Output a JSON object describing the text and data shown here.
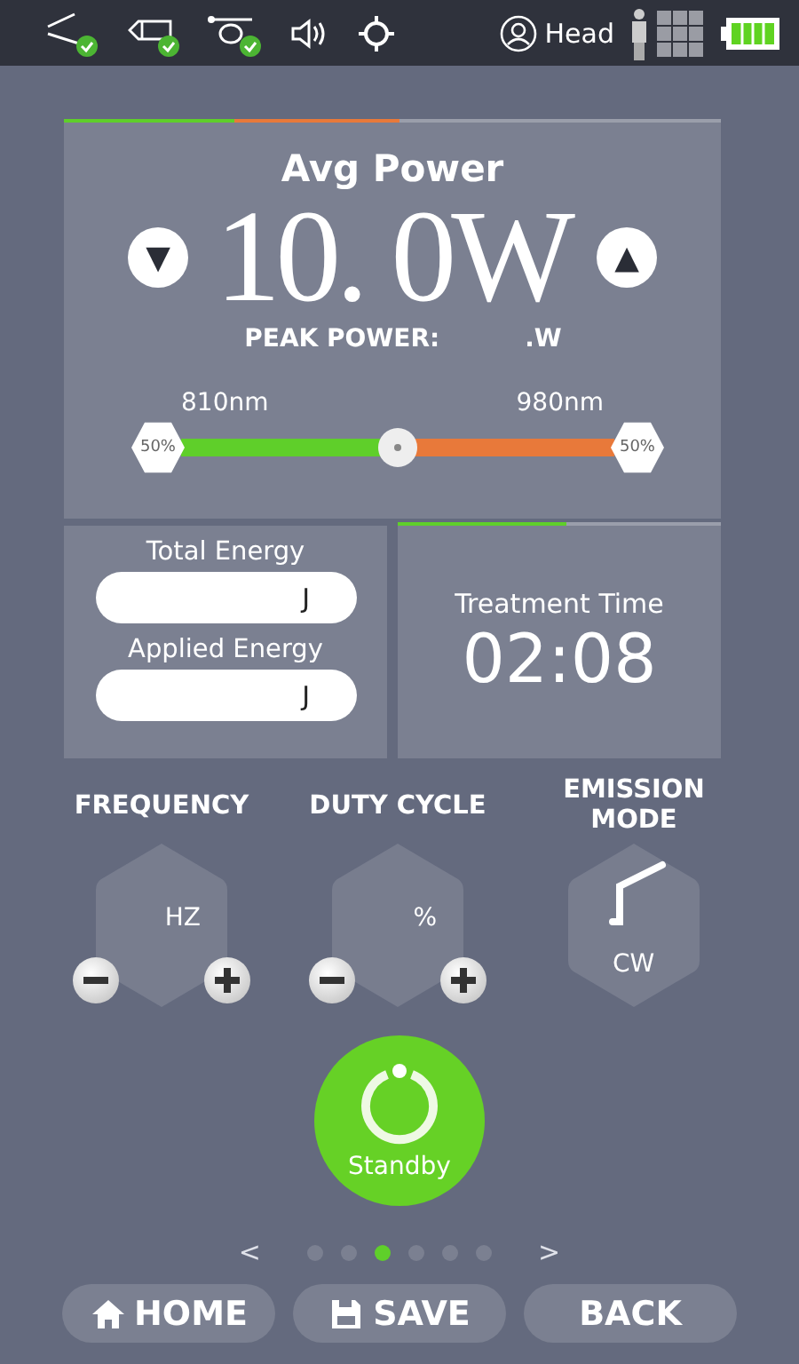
{
  "status_bar": {
    "devices": [
      {
        "kind": "fiber",
        "checked": true
      },
      {
        "kind": "handpiece",
        "checked": true
      },
      {
        "kind": "coil",
        "checked": true
      }
    ],
    "profile": "Head"
  },
  "power": {
    "indicator": [
      {
        "color": "#e8793a",
        "level": 0.51
      },
      {
        "color": "#5fcf2a",
        "level": 0.26
      }
    ],
    "title": "Avg Power",
    "value": "10. 0W",
    "decrease": "▼",
    "increase": "▲",
    "peak_label": "PEAK POWER:",
    "peak_value": ".W",
    "mix": {
      "left_label": "810nm",
      "left_percent": "50%",
      "right_label": "980nm",
      "right_percent": "50%",
      "level": 0.5
    }
  },
  "energy": [
    {
      "label": "Total Energy",
      "unit": "J"
    },
    {
      "label": "Applied Energy",
      "unit": "J"
    }
  ],
  "treatment": {
    "indicator": {
      "level": 0.52
    },
    "label": "Treatment Time",
    "time": "02:08"
  },
  "settings": [
    {
      "kind": "stepper",
      "title": "FREQUENCY",
      "unit": "HZ"
    },
    {
      "kind": "stepper",
      "title": "DUTY CYCLE",
      "unit": "%"
    },
    {
      "kind": "mode",
      "title": "EMISSION MODE",
      "unit": "CW"
    }
  ],
  "standby": {
    "label": "Standby"
  },
  "pager": {
    "prev": "<",
    "next": ">",
    "pages": [
      {
        "selected": false
      },
      {
        "selected": false
      },
      {
        "selected": true
      },
      {
        "selected": false
      },
      {
        "selected": false
      },
      {
        "selected": false
      }
    ]
  },
  "nav": [
    {
      "kind": "home",
      "label": "HOME"
    },
    {
      "kind": "save",
      "label": "SAVE"
    },
    {
      "kind": "back",
      "label": "BACK"
    }
  ]
}
